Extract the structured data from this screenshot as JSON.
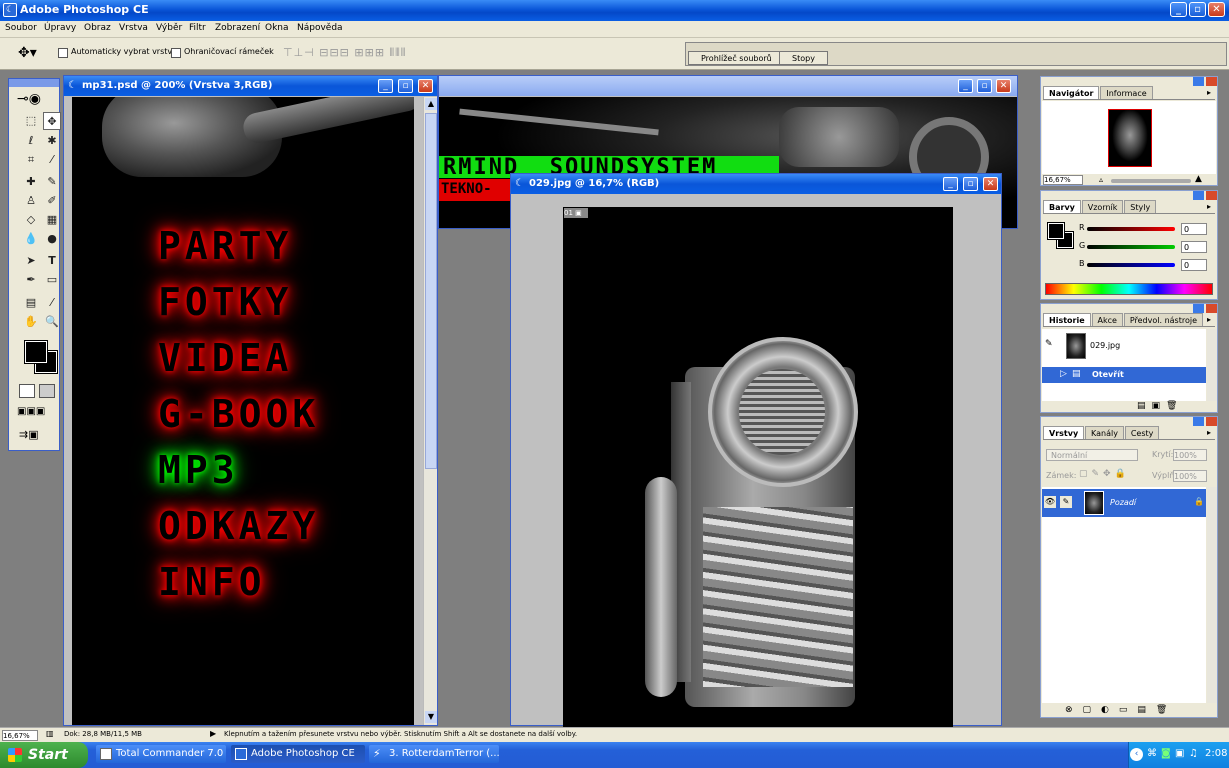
{
  "app": {
    "title": "Adobe Photoshop CE"
  },
  "menu": [
    "Soubor",
    "Úpravy",
    "Obraz",
    "Vrstva",
    "Výběr",
    "Filtr",
    "Zobrazení",
    "Okna",
    "Nápověda"
  ],
  "options": {
    "auto_select": "Automaticky vybrat vrstvu",
    "bounding_box": "Ohraničovací rámeček",
    "tabs": [
      "Prohlížeč souborů",
      "Stopy"
    ]
  },
  "docs": {
    "mp31": {
      "title": "mp31.psd @ 200% (Vrstva 3,RGB)",
      "items": [
        "PARTY",
        "FOTKY",
        "VIDEA",
        "G-BOOK",
        "MP3",
        "ODKAZY",
        "INFO"
      ]
    },
    "banner": {
      "text1": "RMIND  SOUNDSYSTEM",
      "text2": "TEKNO-"
    },
    "photo": {
      "title": "029.jpg @ 16,7% (RGB)"
    }
  },
  "panels": {
    "navigator": {
      "tabs": [
        "Navigátor",
        "Informace"
      ],
      "zoom": "16,67%"
    },
    "color": {
      "tabs": [
        "Barvy",
        "Vzorník",
        "Styly"
      ],
      "r_label": "R",
      "g_label": "G",
      "b_label": "B",
      "r": "0",
      "g": "0",
      "b": "0"
    },
    "history": {
      "tabs": [
        "Historie",
        "Akce",
        "Předvol. nástroje"
      ],
      "snapshot": "029.jpg",
      "step": "Otevřít"
    },
    "layers": {
      "tabs": [
        "Vrstvy",
        "Kanály",
        "Cesty"
      ],
      "blend": "Normální",
      "opacity_label": "Krytí:",
      "opacity": "100%",
      "lock_label": "Zámek:",
      "fill_label": "Výplň:",
      "fill": "100%",
      "layer_name": "Pozadí"
    }
  },
  "status": {
    "zoom": "16,67%",
    "doc": "Dok: 28,8 MB/11,5 MB",
    "hint": "Klepnutím a tažením přesunete vrstvu nebo výběr. Stisknutím Shift a Alt se dostanete na další volby."
  },
  "taskbar": {
    "start": "Start",
    "tasks": [
      "Total Commander 7.0 ...",
      "Adobe Photoshop CE",
      "3. RotterdamTerror (..."
    ],
    "clock": "2:08"
  },
  "colors": {
    "xp_blue": "#0a56d8",
    "menu_red": "#ff0000",
    "menu_green": "#00ff00"
  }
}
